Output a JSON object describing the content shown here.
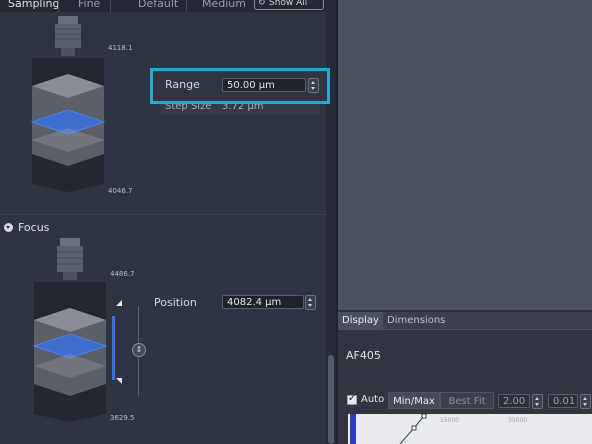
{
  "sampling": {
    "tabs": [
      "Sampling",
      "Fine",
      "Default",
      "Medium"
    ],
    "show_all": "Show All",
    "top_value": "4118.1",
    "bottom_value": "4046.7",
    "range_label": "Range",
    "range_value": "50.00 µm",
    "step_label": "Step Size",
    "step_value": "3.72 µm"
  },
  "focus": {
    "header": "Focus",
    "top_value": "4486.7",
    "bottom_value": "3629.5",
    "position_label": "Position",
    "position_value": "4082.4 µm"
  },
  "display": {
    "tabs": [
      "Display",
      "Dimensions"
    ],
    "channel": "AF405",
    "auto_label": "Auto",
    "auto_checked": true,
    "minmax_label": "Min/Max",
    "bestfit_label": "Best Fit",
    "gamma_value": "2.00",
    "second_value": "0.01",
    "hist_ticks": [
      "15000",
      "35000"
    ]
  },
  "colors": {
    "accent": "#2aa7d8",
    "focus_plane": "#3b6fd9",
    "hist_fill": "#2a3cc0"
  }
}
